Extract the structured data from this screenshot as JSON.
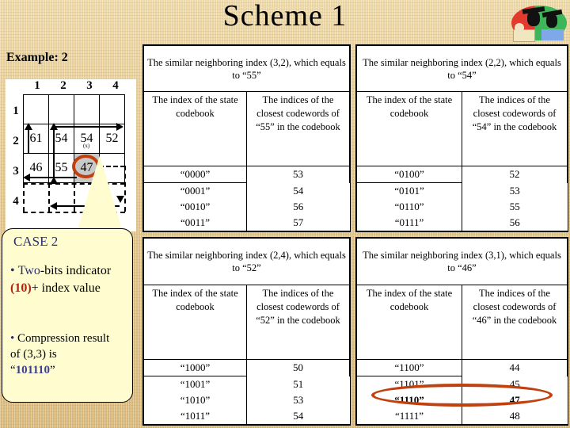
{
  "slide": {
    "title": "Scheme 1",
    "example_label": "Example: 2",
    "logo_name": "graduation-clipart"
  },
  "grid": {
    "col_headers": [
      "1",
      "2",
      "3",
      "4"
    ],
    "row_headers": [
      "1",
      "2",
      "3",
      "4"
    ],
    "cells": [
      [
        "",
        "",
        "",
        ""
      ],
      [
        "61",
        "54",
        "54",
        "52"
      ],
      [
        "46",
        "55",
        "47",
        ""
      ],
      [
        "",
        "",
        "",
        ""
      ]
    ],
    "sub_label": "(x)",
    "highlighted_cell": "47"
  },
  "callout": {
    "case_title": "CASE 2",
    "bullet1_prefix": "Two",
    "bullet1_mid": "-bits indicator ",
    "bullet1_indicator": "(10)",
    "bullet1_suffix": "+ index value",
    "bullet2_line1": "Compression result",
    "bullet2_line2": "of (3,3) is",
    "bullet2_code": "101110",
    "accent_color": "#28306e",
    "indicator_color": "#b3200f",
    "code_color": "#3b3f8f"
  },
  "tables": [
    {
      "id": "top-left",
      "caption": "The similar neighboring index (3,2), which equals to “55”",
      "col1_header": "The index of the state codebook",
      "col2_header": "The indices of the closest codewords of “55” in the codebook",
      "rows": [
        {
          "index": "“0000”",
          "value": "53"
        },
        {
          "index": "“0001”",
          "value": "54"
        },
        {
          "index": "“0010”",
          "value": "56"
        },
        {
          "index": "“0011”",
          "value": "57"
        }
      ]
    },
    {
      "id": "top-right",
      "caption": "The similar neighboring index (2,2), which equals to “54”",
      "col1_header": "The index of the state codebook",
      "col2_header": "The indices of the closest codewords of “54” in the codebook",
      "rows": [
        {
          "index": "“0100”",
          "value": "52"
        },
        {
          "index": "“0101”",
          "value": "53"
        },
        {
          "index": "“0110”",
          "value": "55"
        },
        {
          "index": "“0111”",
          "value": "56"
        }
      ]
    },
    {
      "id": "bottom-left",
      "caption": "The similar neighboring index (2,4), which equals to “52”",
      "col1_header": "The index of the state codebook",
      "col2_header": "The indices of the closest codewords of “52” in the codebook",
      "rows": [
        {
          "index": "“1000”",
          "value": "50"
        },
        {
          "index": "“1001”",
          "value": "51"
        },
        {
          "index": "“1010”",
          "value": "53"
        },
        {
          "index": "“1011”",
          "value": "54"
        }
      ]
    },
    {
      "id": "bottom-right",
      "caption": "The similar neighboring index (3,1), which equals to “46”",
      "col1_header": "The index of the state codebook",
      "col2_header": "The indices of the closest codewords of “46” in the codebook",
      "rows": [
        {
          "index": "“1100”",
          "value": "44"
        },
        {
          "index": "“1101”",
          "value": "45"
        },
        {
          "index": "“1110”",
          "value": "47",
          "highlighted": true
        },
        {
          "index": "“1111”",
          "value": "48"
        }
      ]
    }
  ],
  "colors": {
    "background": "#e4c78d",
    "callout_fill": "#fffdd0",
    "highlight_ellipse": "#c0400f",
    "grid_highlight_fill": "#c9c9c9"
  }
}
